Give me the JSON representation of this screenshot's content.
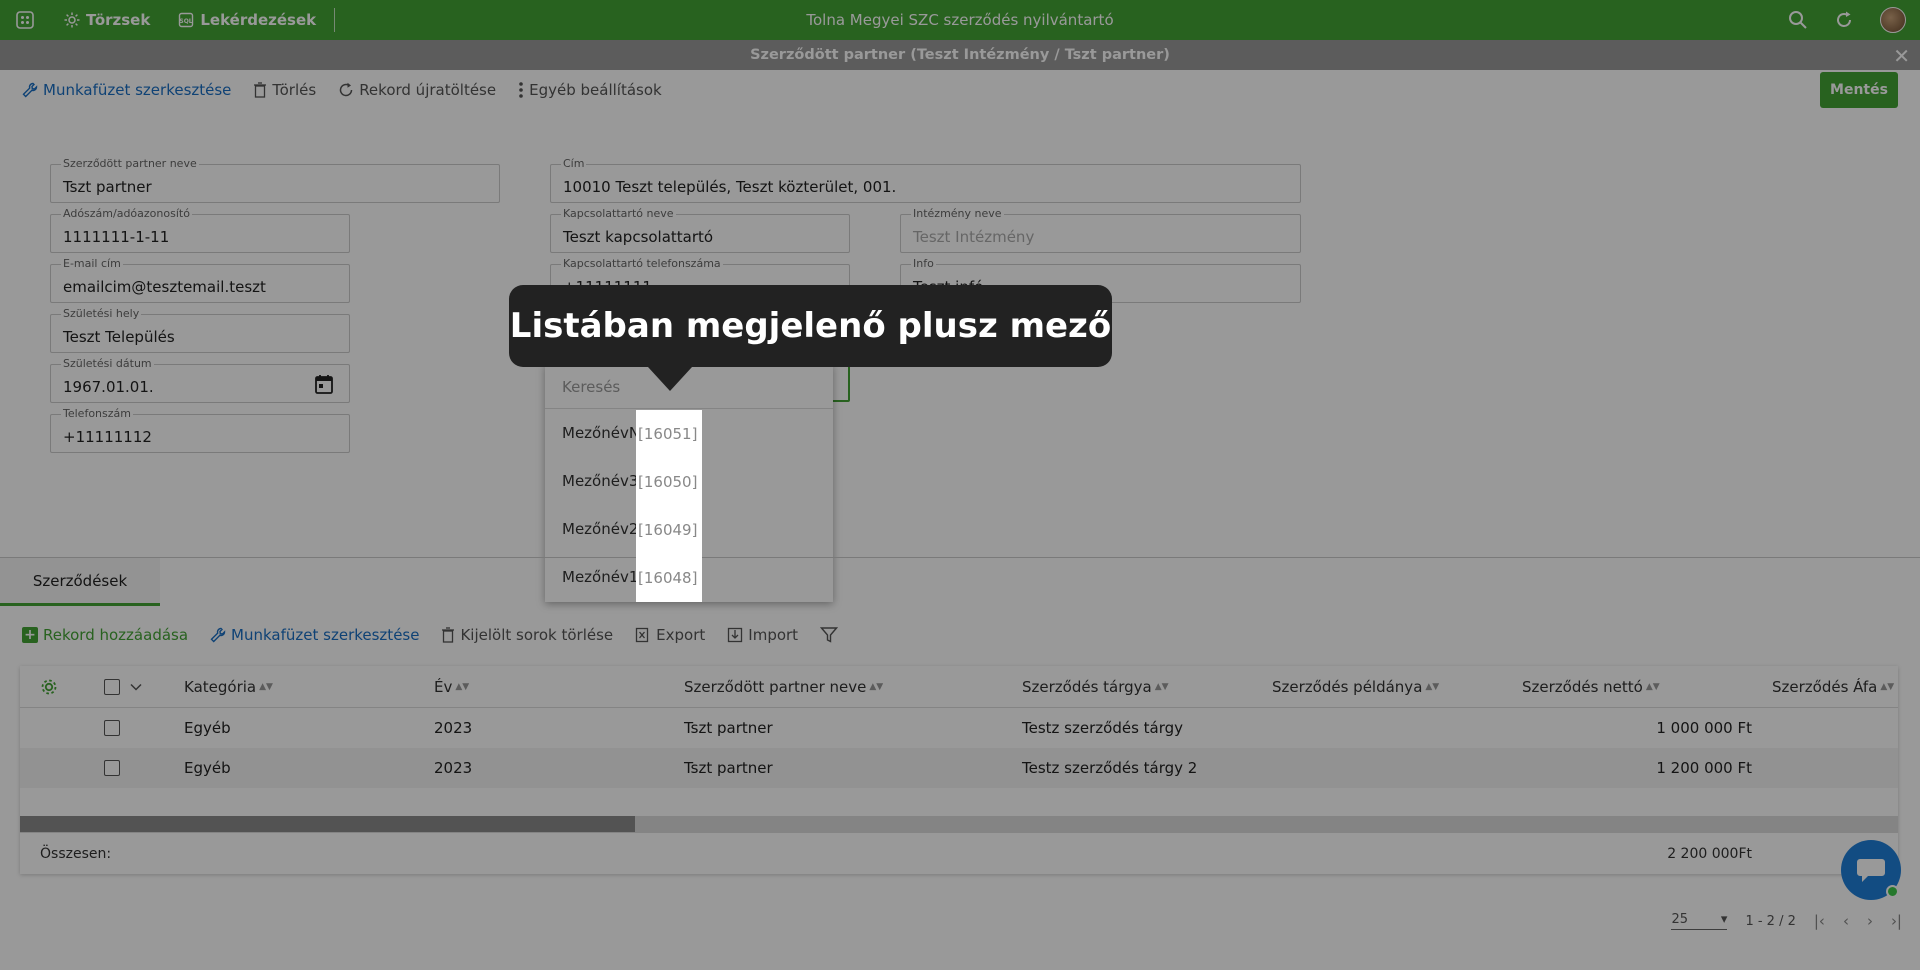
{
  "app": {
    "title": "Tolna Megyei SZC szerződés nyilvántartó",
    "nav": [
      {
        "label": "Törzsek",
        "icon": "gear-icon"
      },
      {
        "label": "Lekérdezések",
        "icon": "query-icon"
      }
    ]
  },
  "dialog": {
    "title": "Szerződött partner (Teszt Intézmény / Tszt partner)"
  },
  "toolbar": {
    "edit_workbook": "Munkafüzet szerkesztése",
    "delete": "Törlés",
    "reload": "Rekord újratöltése",
    "more_settings": "Egyéb beállítások",
    "save": "Mentés"
  },
  "form": {
    "partner_name": {
      "label": "Szerződött partner neve",
      "value": "Tszt partner"
    },
    "tax_id": {
      "label": "Adószám/adóazonosító",
      "value": "1111111-1-11"
    },
    "email": {
      "label": "E-mail cím",
      "value": "emailcim@tesztemail.teszt"
    },
    "birth_place": {
      "label": "Születési hely",
      "value": "Teszt Település"
    },
    "birth_date": {
      "label": "Születési dátum",
      "value": "1967.01.01."
    },
    "phone": {
      "label": "Telefonszám",
      "value": "+11111112"
    },
    "address": {
      "label": "Cím",
      "value": "10010 Teszt település, Teszt közterület, 001."
    },
    "contact_name": {
      "label": "Kapcsolattartó neve",
      "value": "Teszt kapcsolattartó"
    },
    "institution_name": {
      "label": "Intézmény neve",
      "value": "Teszt Intézmény"
    },
    "contact_phone": {
      "label": "Kapcsolattartó telefonszáma",
      "value": "+11111111"
    },
    "info": {
      "label": "Info",
      "value": "Teszt infó"
    }
  },
  "dropdown": {
    "search_placeholder": "Keresés",
    "items": [
      {
        "name": "MezőnévN",
        "code": "[16051]"
      },
      {
        "name": "Mezőnév3",
        "code": "[16050]"
      },
      {
        "name": "Mezőnév2",
        "code": "[16049]"
      },
      {
        "name": "Mezőnév1",
        "code": "[16048]"
      }
    ]
  },
  "tooltip": {
    "text": "Listában megjelenő plusz mező"
  },
  "bottom": {
    "tab": "Szerződések",
    "toolbar": {
      "add_record": "Rekord hozzáadása",
      "edit_workbook": "Munkafüzet szerkesztése",
      "delete_selected": "Kijelölt sorok törlése",
      "export": "Export",
      "import": "Import"
    },
    "columns": [
      "Kategória",
      "Év",
      "Szerződött partner neve",
      "Szerződés tárgya",
      "Szerződés példánya",
      "Szerződés nettó",
      "Szerződés Áfa"
    ],
    "rows": [
      {
        "category": "Egyéb",
        "year": "2023",
        "partner": "Tszt partner",
        "subject": "Testz szerződés tárgy",
        "copy": "",
        "net": "1 000 000 Ft",
        "vat": ""
      },
      {
        "category": "Egyéb",
        "year": "2023",
        "partner": "Tszt partner",
        "subject": "Testz szerződés tárgy 2",
        "copy": "",
        "net": "1 200 000 Ft",
        "vat": ""
      }
    ],
    "totals": {
      "label": "Összesen:",
      "net": "2 200 000Ft"
    },
    "pager": {
      "page_size": "25",
      "range": "1 - 2 / 2"
    }
  }
}
